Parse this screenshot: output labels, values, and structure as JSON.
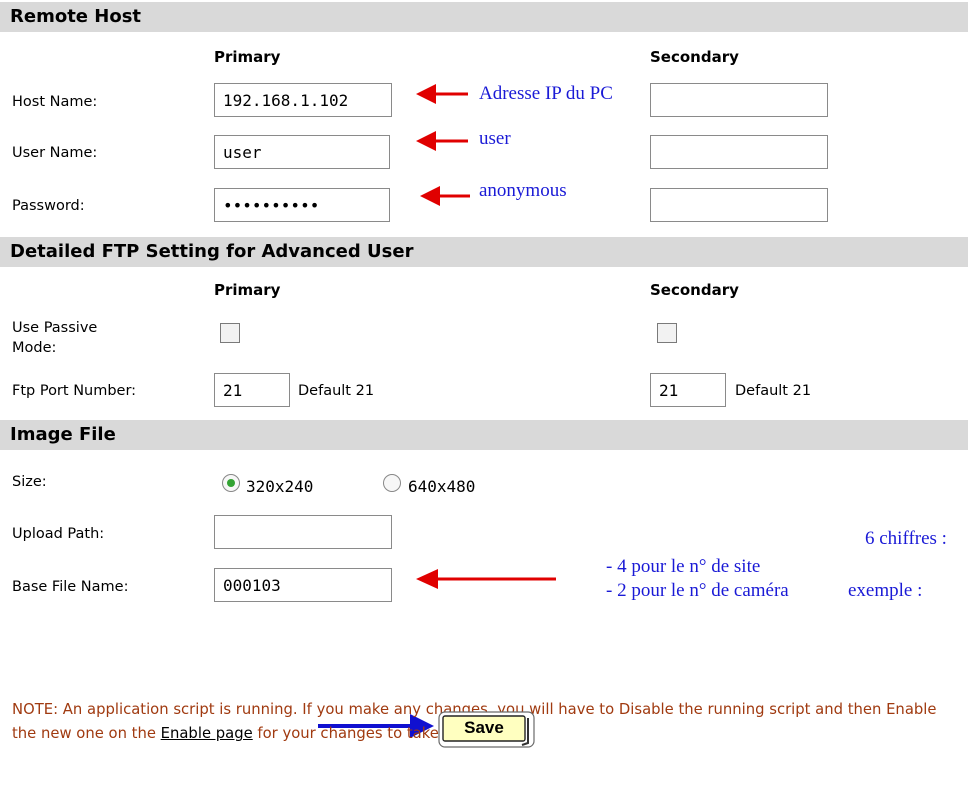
{
  "remote_host": {
    "header": "Remote Host",
    "primary_label": "Primary",
    "secondary_label": "Secondary",
    "host_name_label": "Host Name:",
    "host_name_primary": "192.168.1.102",
    "host_name_secondary": "",
    "user_name_label": "User Name:",
    "user_name_primary": "user",
    "user_name_secondary": "",
    "password_label": "Password:",
    "password_primary": "**********",
    "password_secondary": ""
  },
  "ftp_settings": {
    "header": "Detailed FTP Setting for Advanced User",
    "primary_label": "Primary",
    "secondary_label": "Secondary",
    "passive_label_line1": "Use Passive",
    "passive_label_line2": "Mode:",
    "passive_primary_checked": false,
    "passive_secondary_checked": false,
    "port_label": "Ftp Port Number:",
    "port_primary": "21",
    "port_secondary": "21",
    "default_primary": "Default 21",
    "default_secondary": "Default 21"
  },
  "image_file": {
    "header": "Image File",
    "size_label": "Size:",
    "size_options": [
      "320x240",
      "640x480"
    ],
    "size_selected": "320x240",
    "upload_path_label": "Upload Path:",
    "upload_path": "",
    "base_file_name_label": "Base File Name:",
    "base_file_name": "000103"
  },
  "annotations": {
    "host_ip": "Adresse IP du PC",
    "user": "user",
    "password": "anonymous",
    "digits": "6 chiffres :",
    "site": "- 4 pour le n° de site",
    "camera": "- 2 pour le n° de caméra",
    "example": "exemple :"
  },
  "note": {
    "text_before": "NOTE: An application script is running. If you make any changes, you will have to Disable the running script and then Enable the new one on the ",
    "link": "Enable page",
    "text_after": " for your changes to take effect."
  },
  "save_label": "Save",
  "colors": {
    "header_bg": "#d9d9d9",
    "annotation_blue": "#1a1ad6",
    "arrow_red": "#e00000",
    "arrow_blue": "#1010d0",
    "note_red": "#a03a10",
    "save_bg": "#ffffc0"
  }
}
